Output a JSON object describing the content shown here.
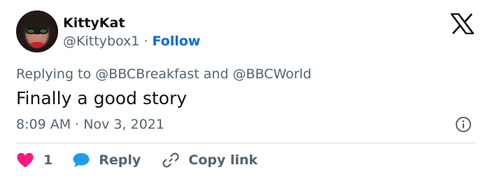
{
  "tweet": {
    "author_name": "KittyKat",
    "author_handle": "@Kittybox1",
    "separator": "·",
    "follow_label": "Follow",
    "replying_to_text": "Replying to @BBCBreakfast and @BBCWorld",
    "text": "Finally a good story",
    "timestamp": "8:09 AM · Nov 3, 2021"
  },
  "actions": {
    "like_count": "1",
    "reply_label": "Reply",
    "copy_link_label": "Copy link"
  },
  "colors": {
    "heart": "#f91880",
    "reply_bubble": "#1d9bf0",
    "follow": "#006fd6",
    "muted": "#536471"
  },
  "icons": {
    "brand": "x-logo-icon",
    "info": "info-icon",
    "like": "heart-icon",
    "reply": "speech-bubble-icon",
    "copy": "link-icon"
  }
}
